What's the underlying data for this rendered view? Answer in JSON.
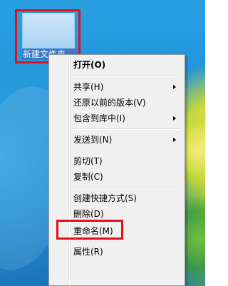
{
  "desktop": {
    "folder_label": "新建文件夹"
  },
  "menu": {
    "items": [
      {
        "label": "打开(O)",
        "bold": true,
        "submenu": false
      },
      {
        "label": "共享(H)",
        "submenu": true
      },
      {
        "label": "还原以前的版本(V)",
        "submenu": false
      },
      {
        "label": "包含到库中(I)",
        "submenu": true
      },
      {
        "label": "发送到(N)",
        "submenu": true
      },
      {
        "label": "剪切(T)",
        "submenu": false
      },
      {
        "label": "复制(C)",
        "submenu": false
      },
      {
        "label": "创建快捷方式(S)",
        "submenu": false
      },
      {
        "label": "删除(D)",
        "submenu": false
      },
      {
        "label": "重命名(M)",
        "submenu": false
      },
      {
        "label": "属性(R)",
        "submenu": false
      }
    ]
  },
  "colors": {
    "highlight_box": "#e5111a",
    "menu_bg": "#f0f0f0",
    "desktop_blue": "#1e8fd6"
  }
}
